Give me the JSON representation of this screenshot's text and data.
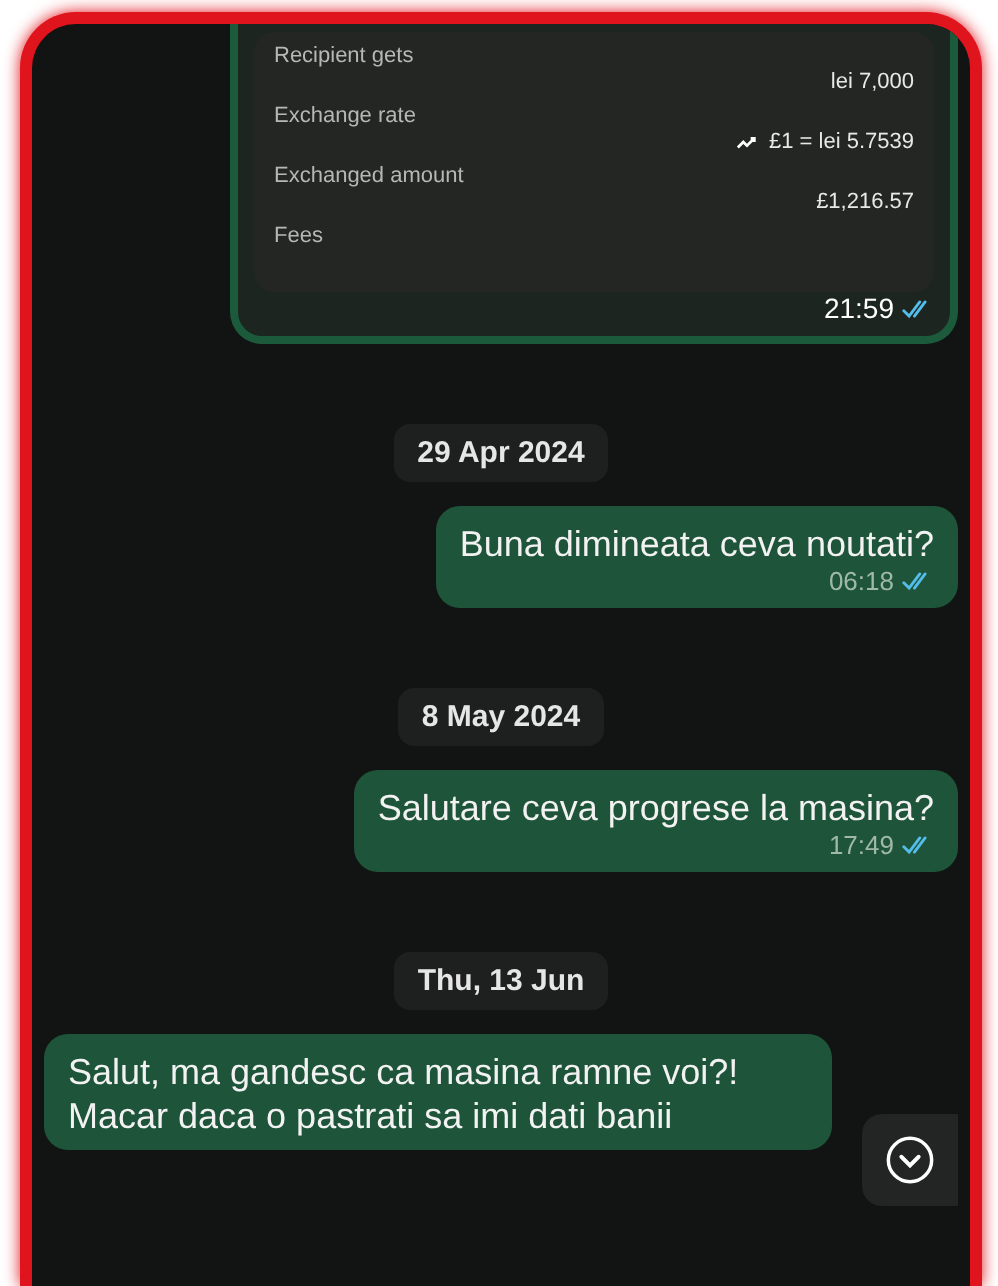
{
  "transfer_card": {
    "rows": [
      {
        "label": "Recipient gets",
        "value": "lei 7,000"
      },
      {
        "label": "Exchange rate",
        "value": "£1 = lei 5.7539",
        "trend": true
      },
      {
        "label": "Exchanged amount",
        "value": "£1,216.57"
      },
      {
        "label": "Fees"
      }
    ],
    "time": "21:59",
    "read": true
  },
  "chat": [
    {
      "kind": "date",
      "text": "29 Apr 2024"
    },
    {
      "kind": "message",
      "lines": [
        "Buna dimineata ceva noutati?"
      ],
      "time": "06:18",
      "read": true
    },
    {
      "kind": "date",
      "text": "8 May 2024"
    },
    {
      "kind": "message",
      "lines": [
        "Salutare ceva progrese la masina?"
      ],
      "time": "17:49",
      "read": true
    },
    {
      "kind": "date",
      "text": "Thu, 13 Jun"
    },
    {
      "kind": "message",
      "lines": [
        "Salut, ma gandesc ca masina ramne voi?!",
        "Macar daca o pastrati sa imi dati banii"
      ]
    }
  ],
  "scroll_down_button": true
}
